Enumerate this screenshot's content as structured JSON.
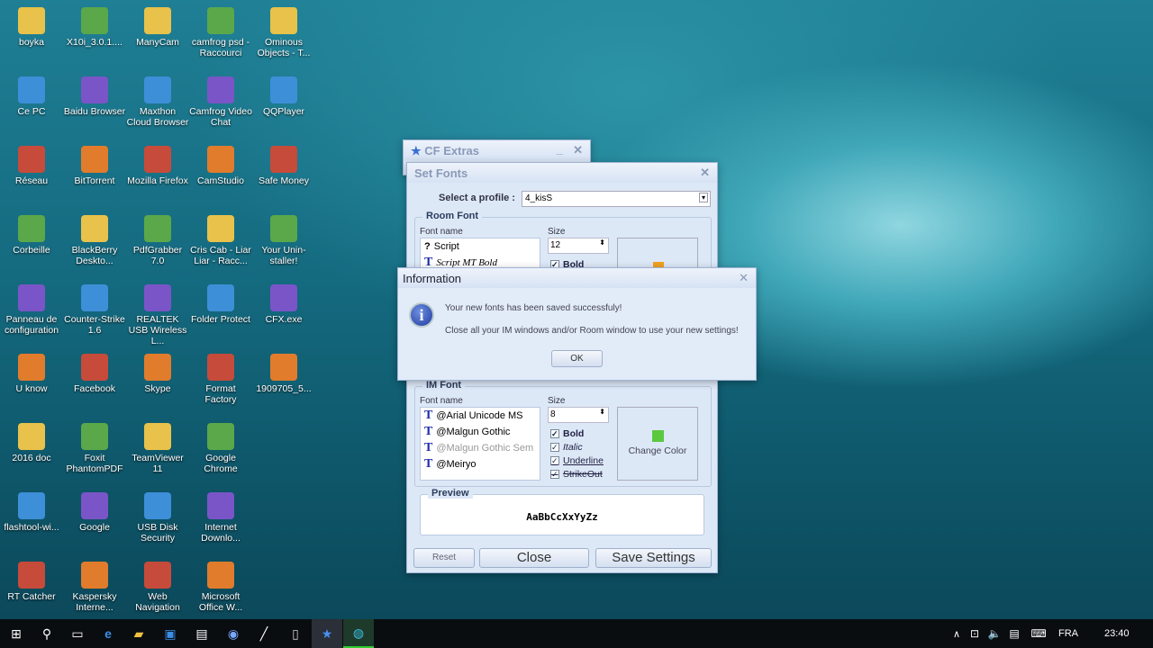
{
  "desktop_icons": [
    [
      "boyka",
      "Ce PC",
      "Réseau",
      "Corbeille",
      "Panneau de configuration",
      "U know",
      "2016 doc",
      "flashtool-wi...",
      "RT Catcher"
    ],
    [
      "X10i_3.0.1....",
      "Baidu Browser",
      "BitTorrent",
      "BlackBerry Deskto...",
      "Counter-Strike 1.6",
      "Facebook",
      "Foxit PhantomPDF",
      "Google",
      "Kaspersky Interne..."
    ],
    [
      "ManyCam",
      "Maxthon Cloud Browser",
      "Mozilla Firefox",
      "PdfGrabber 7.0",
      "REALTEK USB Wireless L...",
      "Skype",
      "TeamViewer 11",
      "USB Disk Security",
      "Web Navigation"
    ],
    [
      "camfrog psd - Raccourci",
      "Camfrog Video Chat",
      "CamStudio",
      "Cris Cab - Liar Liar - Racc...",
      "Folder Protect",
      "Format Factory",
      "Google Chrome",
      "Internet Downlo...",
      "Microsoft Office W..."
    ],
    [
      "Ominous Objects - T...",
      "QQPlayer",
      "Safe Money",
      "Your Unin-staller!",
      "CFX.exe",
      "1909705_5..."
    ]
  ],
  "icon_colors": [
    "#e8c24a",
    "#3d8fd8",
    "#c64b3a",
    "#5aa84a",
    "#7a55c8",
    "#e07c2c"
  ],
  "cf_extras": {
    "title": "CF Extras"
  },
  "set_fonts": {
    "title": "Set Fonts",
    "profile_label": "Select a profile :",
    "profile_value": "4_kisS",
    "room_font": {
      "label": "Room Font",
      "font_name_label": "Font name",
      "size_label": "Size",
      "size": "12",
      "fonts": [
        "Script",
        "Script MT Bold"
      ],
      "bold": "Bold",
      "color": "#f0a020"
    },
    "im_font": {
      "label": "IM Font",
      "font_name_label": "Font name",
      "size_label": "Size",
      "size": "8",
      "fonts": [
        "@Arial Unicode MS",
        "@Malgun Gothic",
        "@Malgun Gothic Sem",
        "@Meiryo"
      ],
      "bold": "Bold",
      "italic": "Italic",
      "underline": "Underline",
      "strikeout": "StrikeOut",
      "change_color": "Change Color",
      "color": "#5cc840"
    },
    "preview_label": "Preview",
    "preview_text": "AaBbCcXxYyZz",
    "reset": "Reset",
    "close": "Close",
    "save": "Save Settings"
  },
  "info": {
    "title": "Information",
    "line1": "Your new fonts has been saved successfuly!",
    "line2": "Close all your IM windows and/or Room window to use your new settings!",
    "ok": "OK"
  },
  "taskbar": {
    "lang": "FRA",
    "time": "23:40"
  }
}
